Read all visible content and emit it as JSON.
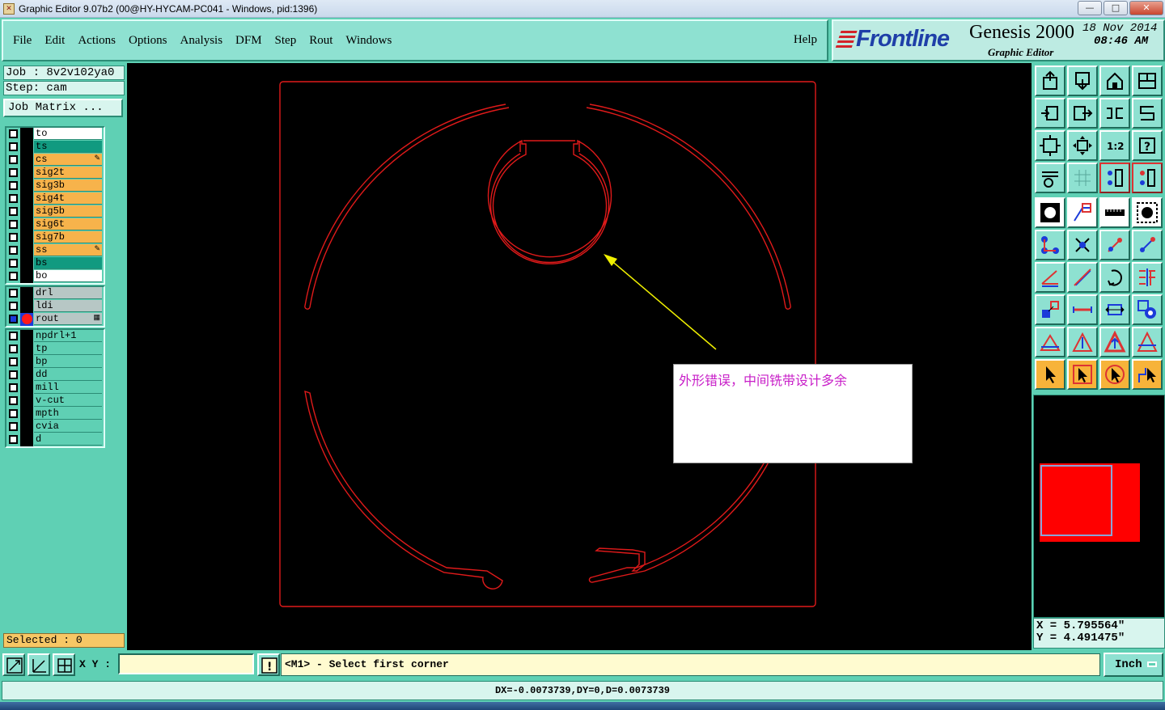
{
  "window": {
    "title": "Graphic Editor 9.07b2 (00@HY-HYCAM-PC041 - Windows, pid:1396)",
    "controls": [
      "—",
      "□",
      "✕"
    ]
  },
  "menu": {
    "items": [
      "File",
      "Edit",
      "Actions",
      "Options",
      "Analysis",
      "DFM",
      "Step",
      "Rout",
      "Windows"
    ],
    "help": "Help"
  },
  "brand": {
    "logo": "Frontline",
    "product": "Genesis 2000",
    "subtitle": "Graphic Editor",
    "date": "18 Nov 2014",
    "time": "08:46 AM"
  },
  "job": {
    "job_line": "Job : 8v2v102ya0",
    "step_line": "Step: cam",
    "matrix_button": "Job Matrix ..."
  },
  "layers": {
    "board": [
      {
        "name": "to",
        "color": "#ffffff",
        "marker": ""
      },
      {
        "name": "ts",
        "color": "#119a80",
        "marker": ""
      },
      {
        "name": "cs",
        "color": "#f7b34b",
        "marker": "✎"
      },
      {
        "name": "sig2t",
        "color": "#f7b34b",
        "marker": ""
      },
      {
        "name": "sig3b",
        "color": "#f7b34b",
        "marker": ""
      },
      {
        "name": "sig4t",
        "color": "#f7b34b",
        "marker": ""
      },
      {
        "name": "sig5b",
        "color": "#f7b34b",
        "marker": ""
      },
      {
        "name": "sig6t",
        "color": "#f7b34b",
        "marker": ""
      },
      {
        "name": "sig7b",
        "color": "#f7b34b",
        "marker": ""
      },
      {
        "name": "ss",
        "color": "#f7b34b",
        "marker": "✎"
      },
      {
        "name": "bs",
        "color": "#119a80",
        "marker": ""
      },
      {
        "name": "bo",
        "color": "#ffffff",
        "marker": ""
      }
    ],
    "drill": [
      {
        "name": "drl",
        "color": "#b7c7c5",
        "marker": ""
      },
      {
        "name": "ldi",
        "color": "#b7c7c5",
        "marker": ""
      },
      {
        "name": "rout",
        "color": "#b7c7c5",
        "marker": "▦",
        "active": true
      }
    ],
    "misc": [
      {
        "name": "npdrl+1",
        "color": "#5fd0b4",
        "marker": ""
      },
      {
        "name": "tp",
        "color": "#5fd0b4",
        "marker": ""
      },
      {
        "name": "bp",
        "color": "#5fd0b4",
        "marker": ""
      },
      {
        "name": "dd",
        "color": "#5fd0b4",
        "marker": ""
      },
      {
        "name": "mill",
        "color": "#5fd0b4",
        "marker": ""
      },
      {
        "name": "v-cut",
        "color": "#5fd0b4",
        "marker": ""
      },
      {
        "name": "mpth",
        "color": "#5fd0b4",
        "marker": ""
      },
      {
        "name": "cvia",
        "color": "#5fd0b4",
        "marker": ""
      },
      {
        "name": "d",
        "color": "#5fd0b4",
        "marker": ""
      }
    ]
  },
  "selected": "Selected : 0",
  "annotation": {
    "text": "外形错误，中间铣带设计多余",
    "text_color": "#c81ec8",
    "arrow_color": "#f0f000"
  },
  "canvas": {
    "rout_color": "#e01a1a",
    "background": "#000000"
  },
  "coords": {
    "x": "X = 5.795564\"",
    "y": "Y = 4.491475\""
  },
  "bottom": {
    "xy_label": "X Y :",
    "xy_value": "",
    "warn": "!",
    "status": "<M1> - Select first corner",
    "unit": "Inch",
    "measure": "DX=-0.0073739,DY=0,D=0.0073739"
  }
}
